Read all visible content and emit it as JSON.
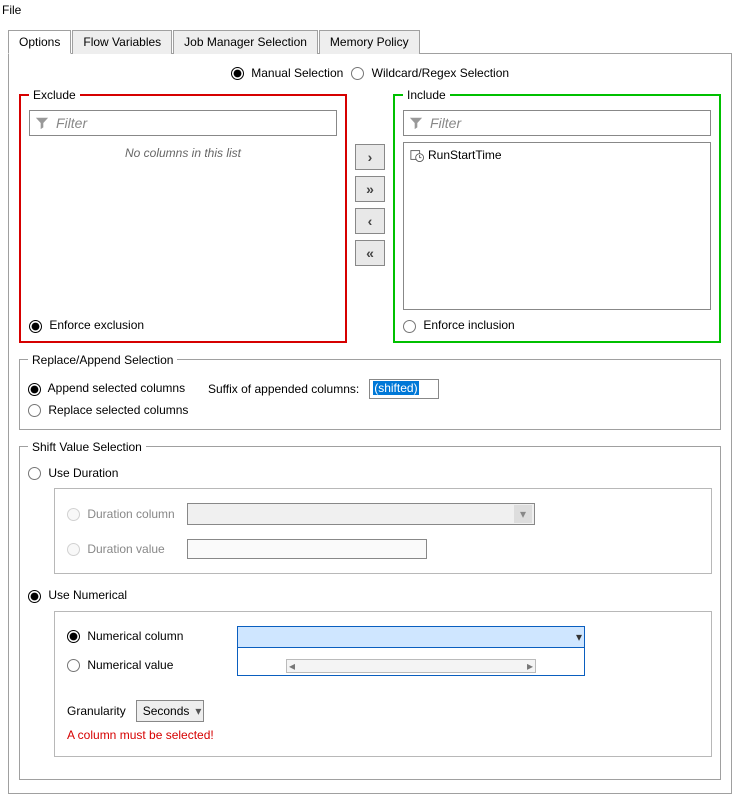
{
  "menu": {
    "file": "File"
  },
  "tabs": [
    "Options",
    "Flow Variables",
    "Job Manager Selection",
    "Memory Policy"
  ],
  "selection_mode": {
    "manual": "Manual Selection",
    "wildcard": "Wildcard/Regex Selection"
  },
  "exclude": {
    "legend": "Exclude",
    "filter_placeholder": "Filter",
    "empty_msg": "No columns in this list",
    "enforce": "Enforce exclusion"
  },
  "include": {
    "legend": "Include",
    "filter_placeholder": "Filter",
    "items": [
      "RunStartTime"
    ],
    "enforce": "Enforce inclusion"
  },
  "move_buttons": {
    "add": "›",
    "add_all": "»",
    "remove": "‹",
    "remove_all": "«"
  },
  "replace_append": {
    "legend": "Replace/Append Selection",
    "append": "Append selected columns",
    "replace": "Replace selected columns",
    "suffix_label": "Suffix of appended columns:",
    "suffix_value": "(shifted)"
  },
  "shift": {
    "legend": "Shift Value Selection",
    "use_duration": "Use Duration",
    "duration_column": "Duration column",
    "duration_value": "Duration value",
    "use_numerical": "Use Numerical",
    "numerical_column": "Numerical column",
    "numerical_value": "Numerical value",
    "granularity_label": "Granularity",
    "granularity_value": "Seconds",
    "error": "A column must be selected!"
  }
}
